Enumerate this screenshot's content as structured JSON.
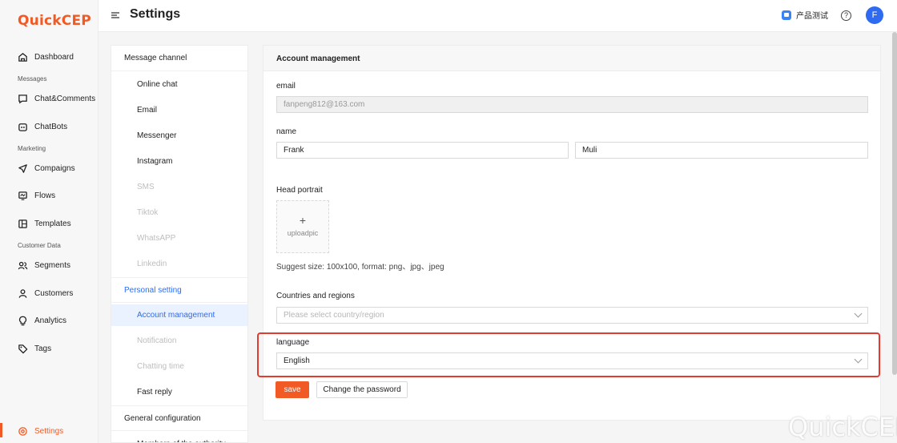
{
  "app": {
    "logo_first": "Q",
    "logo_mid": "uick",
    "logo_last": "CEP"
  },
  "sidebar": {
    "groups": {
      "messages": "Messages",
      "marketing": "Marketing",
      "customer_data": "Customer Data"
    },
    "items": [
      {
        "label": "Dashboard",
        "icon": "home-icon"
      },
      {
        "label": "Chat&Comments",
        "icon": "chat-icon"
      },
      {
        "label": "ChatBots",
        "icon": "bot-icon"
      },
      {
        "label": "Compaigns",
        "icon": "send-icon"
      },
      {
        "label": "Flows",
        "icon": "flow-icon"
      },
      {
        "label": "Templates",
        "icon": "template-icon"
      },
      {
        "label": "Segments",
        "icon": "users-icon"
      },
      {
        "label": "Customers",
        "icon": "user-icon"
      },
      {
        "label": "Analytics",
        "icon": "bulb-icon"
      },
      {
        "label": "Tags",
        "icon": "tag-icon"
      },
      {
        "label": "Settings",
        "icon": "settings-icon"
      }
    ]
  },
  "header": {
    "title": "Settings",
    "org_name": "产品测试",
    "help": "?",
    "avatar_initial": "F"
  },
  "settings_menu": {
    "message_channel": "Message channel",
    "channels": [
      "Online chat",
      "Email",
      "Messenger",
      "Instagram",
      "SMS",
      "Tiktok",
      "WhatsAPP",
      "Linkedin"
    ],
    "personal_setting": "Personal setting",
    "personal": [
      "Account management",
      "Notification",
      "Chatting time",
      "Fast reply"
    ],
    "general_configuration": "General configuration",
    "general": [
      "Members of the authority"
    ]
  },
  "form": {
    "title": "Account management",
    "email_label": "email",
    "email_value": "fanpeng812@163.com",
    "name_label": "name",
    "first_name": "Frank",
    "last_name": "Muli",
    "portrait_label": "Head portrait",
    "upload_plus": "+",
    "upload_text": "uploadpic",
    "portrait_hint": "Suggest size: 100x100, format: png、jpg、jpeg",
    "country_label": "Countries and regions",
    "country_placeholder": "Please select country/region",
    "language_label": "language",
    "language_value": "English",
    "save_label": "save",
    "change_password_label": "Change the password"
  },
  "colors": {
    "brand": "#f15a24",
    "link": "#2f6bf0",
    "highlight": "#e23b2f"
  },
  "watermark": "QuickCEP"
}
